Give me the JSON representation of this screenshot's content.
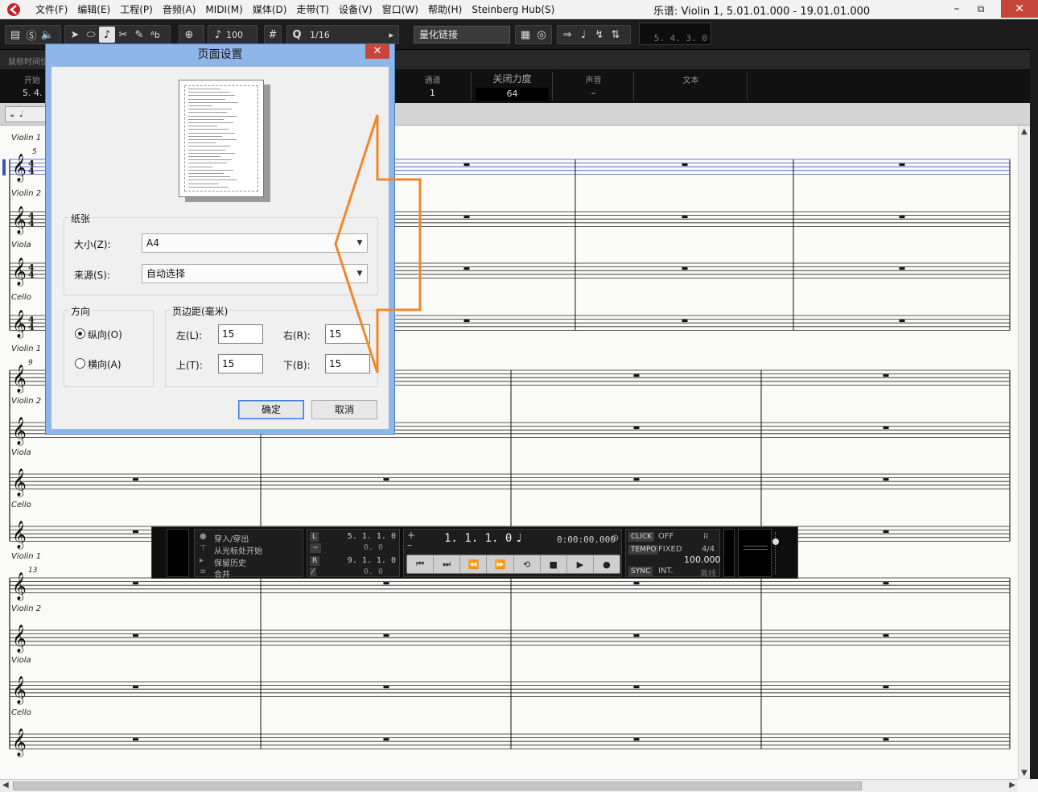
{
  "title_bar": {
    "window_title": "乐谱: Violin 1, 5.01.01.000 - 19.01.01.000",
    "minimize": "–",
    "restore": "⧉",
    "close": "✕"
  },
  "menu": {
    "items": [
      "文件(F)",
      "编辑(E)",
      "工程(P)",
      "音频(A)",
      "MIDI(M)",
      "媒体(D)",
      "走带(T)",
      "设备(V)",
      "窗口(W)",
      "帮助(H)",
      "Steinberg Hub(S)"
    ]
  },
  "toolbar": {
    "velocity": "100",
    "quantize_label": "Q",
    "quantize_value": "1/16",
    "quantize_link": "量化链接",
    "lcd_position": "5. 4. 3.  0"
  },
  "strip": {
    "mouse_time": "鼠标时间位"
  },
  "info_line": {
    "start_label": "开始",
    "start_value": "5. 4.",
    "channel_label": "通道",
    "channel_value": "1",
    "off_velocity_label": "关闭力度",
    "off_velocity_value": "64",
    "voice_label": "声音",
    "voice_value": "–",
    "text_label": "文本"
  },
  "score": {
    "instruments": [
      "Violin 1",
      "Violin 2",
      "Viola",
      "Cello"
    ],
    "measure_numbers": [
      "5",
      "9",
      "13"
    ]
  },
  "dialog": {
    "title": "页面设置",
    "close": "✕",
    "paper_group": "纸张",
    "size_label": "大小(Z):",
    "size_value": "A4",
    "source_label": "来源(S):",
    "source_value": "自动选择",
    "orientation_group": "方向",
    "portrait": "纵向(O)",
    "landscape": "横向(A)",
    "orientation_selected": "portrait",
    "margins_group": "页边距(毫米)",
    "left_label": "左(L):",
    "left_value": "15",
    "right_label": "右(R):",
    "right_value": "15",
    "top_label": "上(T):",
    "top_value": "15",
    "bottom_label": "下(B):",
    "bottom_value": "15",
    "ok": "确定",
    "cancel": "取消"
  },
  "transport": {
    "punch": "穿入/穿出",
    "start_at_cursor": "从光标处开始",
    "keep_history": "保留历史",
    "merge": "合并",
    "left_locator": "5. 1. 1.   0",
    "left_offset": "0.   0",
    "right_locator": "9. 1. 1.   0",
    "right_offset": "0.   0",
    "position": "1.  1.  1.    0",
    "time": "0:00:00.000",
    "click_label": "CLICK",
    "click_value": "OFF",
    "tempo_label": "TEMPO",
    "tempo_mode": "FIXED",
    "signature": "4/4",
    "tempo_value": "100.000",
    "sync_label": "SYNC",
    "sync_value": "INT.",
    "offline": "离线"
  },
  "colors": {
    "annotation_arrow": "#f0872a",
    "dialog_frame": "#8fb6e8",
    "close_red": "#c7463b",
    "toolbar_bg": "#1b1b1b"
  }
}
